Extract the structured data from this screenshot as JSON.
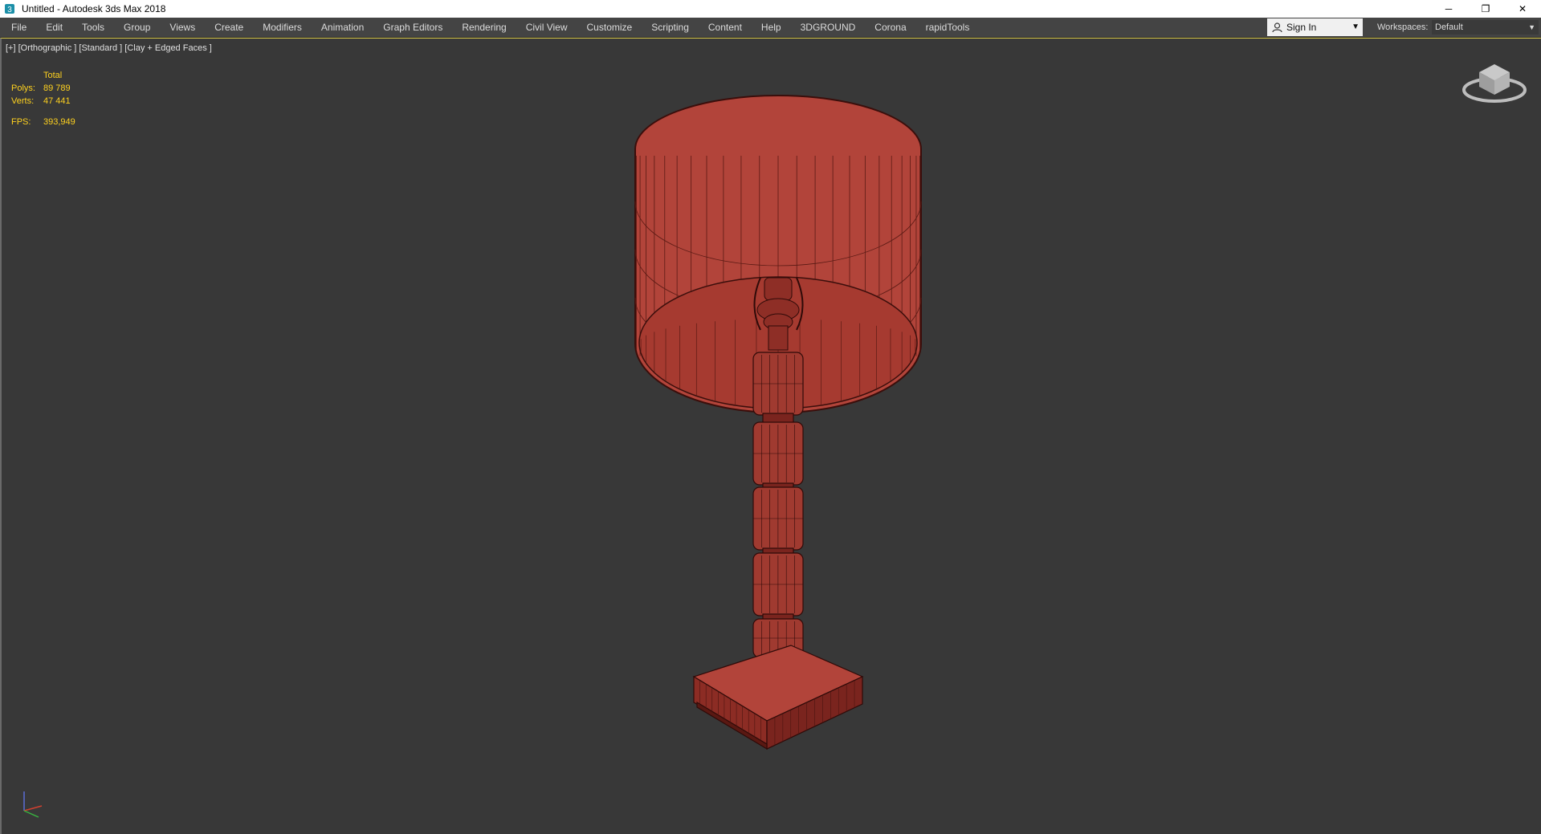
{
  "window": {
    "title": "Untitled - Autodesk 3ds Max 2018",
    "controls": {
      "minimize": "─",
      "restore": "❐",
      "close": "✕"
    }
  },
  "menubar": {
    "items": [
      "File",
      "Edit",
      "Tools",
      "Group",
      "Views",
      "Create",
      "Modifiers",
      "Animation",
      "Graph Editors",
      "Rendering",
      "Civil View",
      "Customize",
      "Scripting",
      "Content",
      "Help",
      "3DGROUND",
      "Corona",
      "rapidTools"
    ],
    "sign_in": "Sign In",
    "workspaces_label": "Workspaces:",
    "workspace_value": "Default"
  },
  "viewport": {
    "label": "[+] [Orthographic ] [Standard ] [Clay + Edged Faces ]",
    "stats": {
      "header": "Total",
      "polys_label": "Polys:",
      "polys": "89 789",
      "verts_label": "Verts:",
      "verts": "47 441",
      "fps_label": "FPS:",
      "fps": "393,949"
    }
  },
  "colors": {
    "viewport_bg": "#383838",
    "stats_text": "#ffd21f",
    "model": "#b2443a",
    "wire": "#4a1410"
  },
  "icons": [
    "app-icon",
    "user-icon",
    "viewcube-icon",
    "axis-tripod-icon"
  ]
}
